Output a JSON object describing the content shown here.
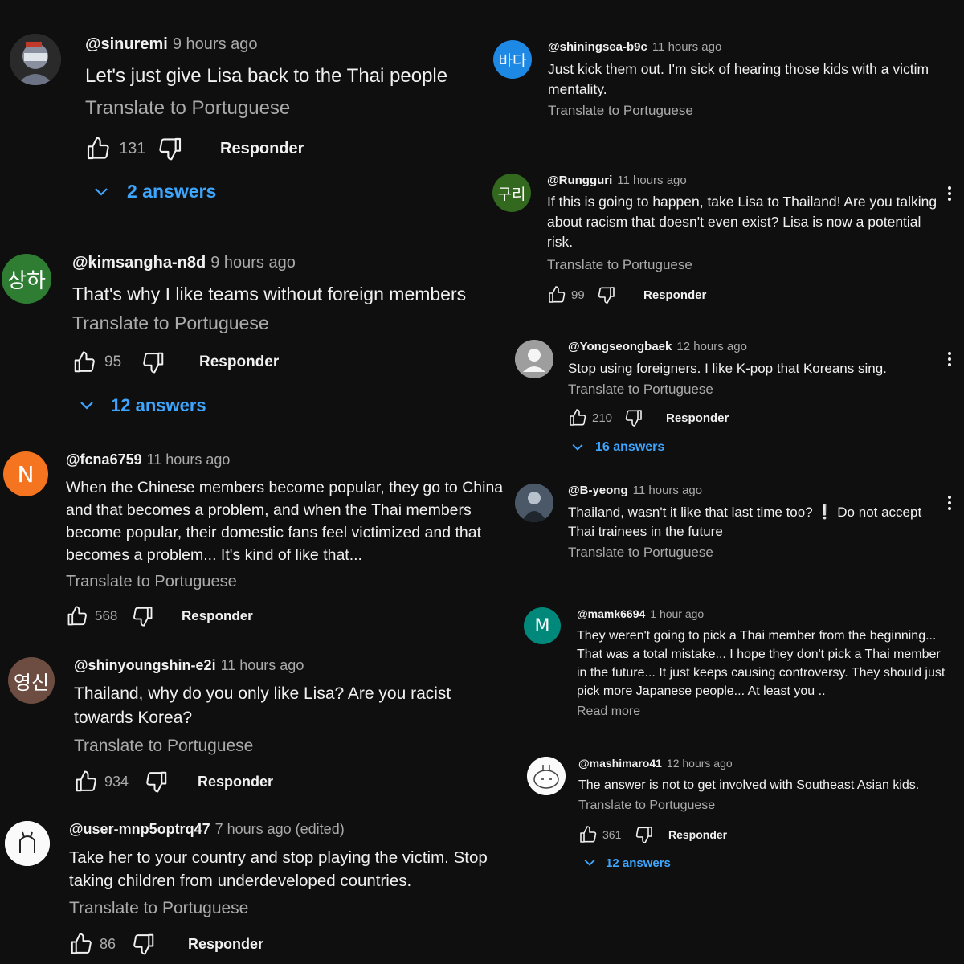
{
  "left": [
    {
      "avatar": "",
      "handle": "@sinuremi",
      "time": "9 hours ago",
      "text": "Let's just give Lisa back to the Thai people",
      "translate": "Translate to Portuguese",
      "likes": "131",
      "reply": "Responder",
      "answers": "2 answers"
    },
    {
      "avatar": "상하",
      "avatar_color": "#2e7d32",
      "handle": "@kimsangha-n8d",
      "time": "9 hours ago",
      "text": "That's why I like teams without foreign members",
      "translate": "Translate to Portuguese",
      "likes": "95",
      "reply": "Responder",
      "answers": "12 answers"
    },
    {
      "avatar": "N",
      "avatar_color": "#f4741f",
      "handle": "@fcna6759",
      "time": "11 hours ago",
      "text": "When the Chinese members become popular, they go to China and that becomes a problem, and when the Thai members become popular, their domestic fans feel victimized and that becomes a problem... It's kind of like that...",
      "translate": "Translate to Portuguese",
      "likes": "568",
      "reply": "Responder"
    },
    {
      "avatar": "영신",
      "avatar_color": "#6d4c41",
      "handle": "@shinyoungshin-e2i",
      "time": "11 hours ago",
      "text": "Thailand, why do you only like Lisa? Are you racist towards Korea?",
      "translate": "Translate to Portuguese",
      "likes": "934",
      "reply": "Responder"
    },
    {
      "avatar": "",
      "handle": "@user-mnp5optrq47",
      "time": "7 hours ago (edited)",
      "text": "Take her to your country and stop playing the victim. Stop taking children from underdeveloped countries.",
      "translate": "Translate to Portuguese",
      "likes": "86",
      "reply": "Responder"
    }
  ],
  "right": [
    {
      "avatar": "바다",
      "avatar_color": "#1e88e5",
      "handle": "@shiningsea-b9c",
      "time": "11 hours ago",
      "text": "Just kick them out. I'm sick of hearing those kids with a victim mentality.",
      "translate": "Translate to Portuguese"
    },
    {
      "avatar": "구리",
      "avatar_color": "#33691e",
      "handle": "@Rungguri",
      "time": "11 hours ago",
      "text": "If this is going to happen, take Lisa to Thailand! Are you talking about racism that doesn't even exist? Lisa is now a potential risk.",
      "translate": "Translate to Portuguese",
      "likes": "99",
      "reply": "Responder"
    },
    {
      "avatar": "",
      "handle": "@Yongseongbaek",
      "time": "12 hours ago",
      "text": "Stop using foreigners. I like K-pop that Koreans sing.",
      "translate": "Translate to Portuguese",
      "likes": "210",
      "reply": "Responder",
      "answers": "16 answers"
    },
    {
      "avatar": "",
      "handle": "@B-yeong",
      "time": "11 hours ago",
      "text": "Thailand, wasn't it like that last time too? ❕ Do not accept Thai trainees in the future",
      "translate": "Translate to Portuguese"
    },
    {
      "avatar": "M",
      "avatar_color": "#00897b",
      "handle": "@mamk6694",
      "time": "1 hour ago",
      "text": "They weren't going to pick a Thai member from the beginning... That was a total mistake... I hope they don't pick a Thai member in the future... It just keeps causing controversy. They should just pick more Japanese people... At least you ..",
      "readmore": "Read more"
    },
    {
      "avatar": "",
      "handle": "@mashimaro41",
      "time": "12 hours ago",
      "text": "The answer is not to get involved with Southeast Asian kids.",
      "translate": "Translate to Portuguese",
      "likes": "361",
      "reply": "Responder",
      "answers": "12 answers"
    }
  ]
}
